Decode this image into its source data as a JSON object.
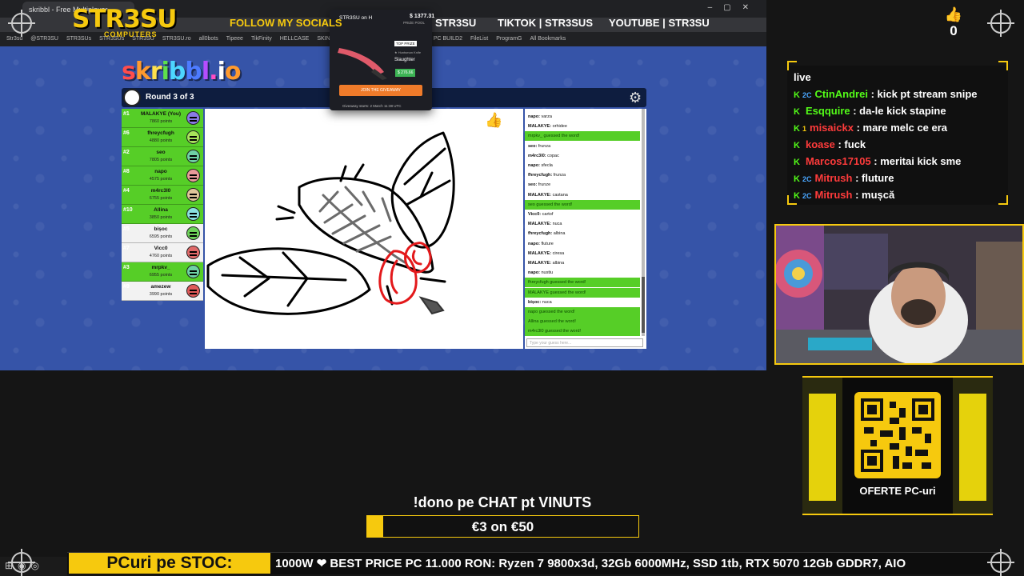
{
  "browser": {
    "tab_title": "skribbl - Free Multiplayer...",
    "bookmarks": [
      "Str3su",
      "@STR3SU",
      "STR3SUs",
      "STR3SUs",
      "STR3SU",
      "STR3SU.ro",
      "all0bots",
      "Tipeee",
      "TikFinity",
      "HELLCASE",
      "SKIN.P...",
      "Yahoo",
      "OLX",
      "HETV",
      "price",
      "PC BUILD2",
      "FileList",
      "ProgramG",
      "All Bookmarks"
    ]
  },
  "overlay": {
    "logo": "STR3SU",
    "logo_sub": "COMPUTERS",
    "follow": "FOLLOW MY SOCIALS",
    "socials": [
      {
        "name": "",
        "handle": "STR3SU"
      },
      {
        "name": "TIKTOK",
        "handle": "STR3SUS"
      },
      {
        "name": "YOUTUBE",
        "handle": "STR3SU"
      }
    ],
    "likes_count": "0",
    "accent_color": "#f6c90e"
  },
  "giveaway": {
    "title": "STR3SU on H",
    "pool_amount": "1377.31",
    "pool_label": "PRIZE POOL",
    "badge": "TOP PRIZE",
    "item_name": "Slaughter",
    "item_sub": "★ Huntsman Knife",
    "price": "$ 276.66",
    "join_label": "JOIN THE GIVEAWAY",
    "starts": "Giveaway starts: 2 March 11:38 UTC"
  },
  "game": {
    "logo": "skribbl.io",
    "round_text": "Round 3 of 3",
    "players": [
      {
        "rank": "#1",
        "name": "MALAKYE (You)",
        "points": "7860 points",
        "color": "#56ce27",
        "avatar": "#8a7ae6"
      },
      {
        "rank": "#6",
        "name": "fhreycfugh",
        "points": "4880 points",
        "color": "#56ce27",
        "avatar": "#a7e35a"
      },
      {
        "rank": "#2",
        "name": "seo",
        "points": "7805 points",
        "color": "#56ce27",
        "avatar": "#6ed1a5"
      },
      {
        "rank": "#8",
        "name": "napo",
        "points": "4575 points",
        "color": "#56ce27",
        "avatar": "#e89a9a"
      },
      {
        "rank": "#4",
        "name": "m4rc3l0",
        "points": "6755 points",
        "color": "#56ce27",
        "avatar": "#e0c59a"
      },
      {
        "rank": "#10",
        "name": "Allina",
        "points": "3850 points",
        "color": "#56ce27",
        "avatar": "#8ae0e0"
      },
      {
        "rank": "#5",
        "name": "bișoc",
        "points": "6595 points",
        "color": "#f2f2f2",
        "avatar": "#6ed15a"
      },
      {
        "rank": "#7",
        "name": "Vicc0",
        "points": "4760 points",
        "color": "#f2f2f2",
        "avatar": "#e06a6a"
      },
      {
        "rank": "#3",
        "name": "mrpkv_",
        "points": "6955 points",
        "color": "#56ce27",
        "avatar": "#6ed1a5"
      },
      {
        "rank": "#9",
        "name": "amezew",
        "points": "3990 points",
        "color": "#f2f2f2",
        "avatar": "#e05a5a"
      }
    ],
    "chat": [
      {
        "user": "napo",
        "text": "varza",
        "guessed": false
      },
      {
        "user": "MALAKYE",
        "text": "orhidee",
        "guessed": false
      },
      {
        "user": "",
        "text": "mrpkv_ guessed the word!",
        "guessed": true
      },
      {
        "user": "seo",
        "text": "frunza",
        "guessed": false
      },
      {
        "user": "m4rc3l0",
        "text": "copac",
        "guessed": false
      },
      {
        "user": "napo",
        "text": "sfecla",
        "guessed": false
      },
      {
        "user": "fhreycfugh",
        "text": "frunza",
        "guessed": false
      },
      {
        "user": "seo",
        "text": "frunze",
        "guessed": false
      },
      {
        "user": "MALAKYE",
        "text": "castana",
        "guessed": false
      },
      {
        "user": "",
        "text": "seo guessed the word!",
        "guessed": true
      },
      {
        "user": "Vicc0",
        "text": "cartof",
        "guessed": false
      },
      {
        "user": "MALAKYE",
        "text": "nuca",
        "guessed": false
      },
      {
        "user": "fhreycfugh",
        "text": "albina",
        "guessed": false
      },
      {
        "user": "napo",
        "text": "fluture",
        "guessed": false
      },
      {
        "user": "MALAKYE",
        "text": "ciresa",
        "guessed": false
      },
      {
        "user": "MALAKYE",
        "text": "albina",
        "guessed": false
      },
      {
        "user": "napo",
        "text": "nustiu",
        "guessed": false
      },
      {
        "user": "",
        "text": "fhreycfugh guessed the word!",
        "guessed": true
      },
      {
        "user": "",
        "text": "MALAKYE guessed the word!",
        "guessed": true
      },
      {
        "user": "bișoc",
        "text": "nuca",
        "guessed": false
      },
      {
        "user": "",
        "text": "napo guessed the word!",
        "guessed": true
      },
      {
        "user": "",
        "text": "Allina guessed the word!",
        "guessed": true
      },
      {
        "user": "",
        "text": "m4rc3l0 guessed the word!",
        "guessed": true
      }
    ],
    "chat_placeholder": "Type your guess here..."
  },
  "stream_chat": {
    "title": "live",
    "messages": [
      {
        "user": "CtinAndrei",
        "text": "kick pt stream snipe",
        "color": "#53fc18",
        "badge": "2C"
      },
      {
        "user": "Esqquire",
        "text": "da-le kick stapine",
        "color": "#53fc18",
        "badge": ""
      },
      {
        "user": "misaickx",
        "text": "mare melc ce era",
        "color": "#ff3b3b",
        "badge": "1"
      },
      {
        "user": "koase",
        "text": "fuck",
        "color": "#ff3b3b",
        "badge": ""
      },
      {
        "user": "Marcos17105",
        "text": "meritai kick sme",
        "color": "#ff3b3b",
        "badge": ""
      },
      {
        "user": "Mitrush",
        "text": "fluture",
        "color": "#ff3b3b",
        "badge": "2C"
      },
      {
        "user": "Mitrush",
        "text": "mușcă",
        "color": "#ff3b3b",
        "badge": "2C"
      }
    ]
  },
  "promo": {
    "label": "OFERTE PC-uri"
  },
  "donation": {
    "title": "!dono pe CHAT pt VINUTS",
    "goal_text": "€3 on €50",
    "progress": 0.06
  },
  "ticker": {
    "label": "PCuri pe STOC:",
    "text": "1000W ❤ BEST PRICE PC 11.000 RON: Ryzen 7 9800x3d, 32Gb 6000MHz, SSD 1tb, RTX 5070 12Gb GDDR7, AIO"
  }
}
